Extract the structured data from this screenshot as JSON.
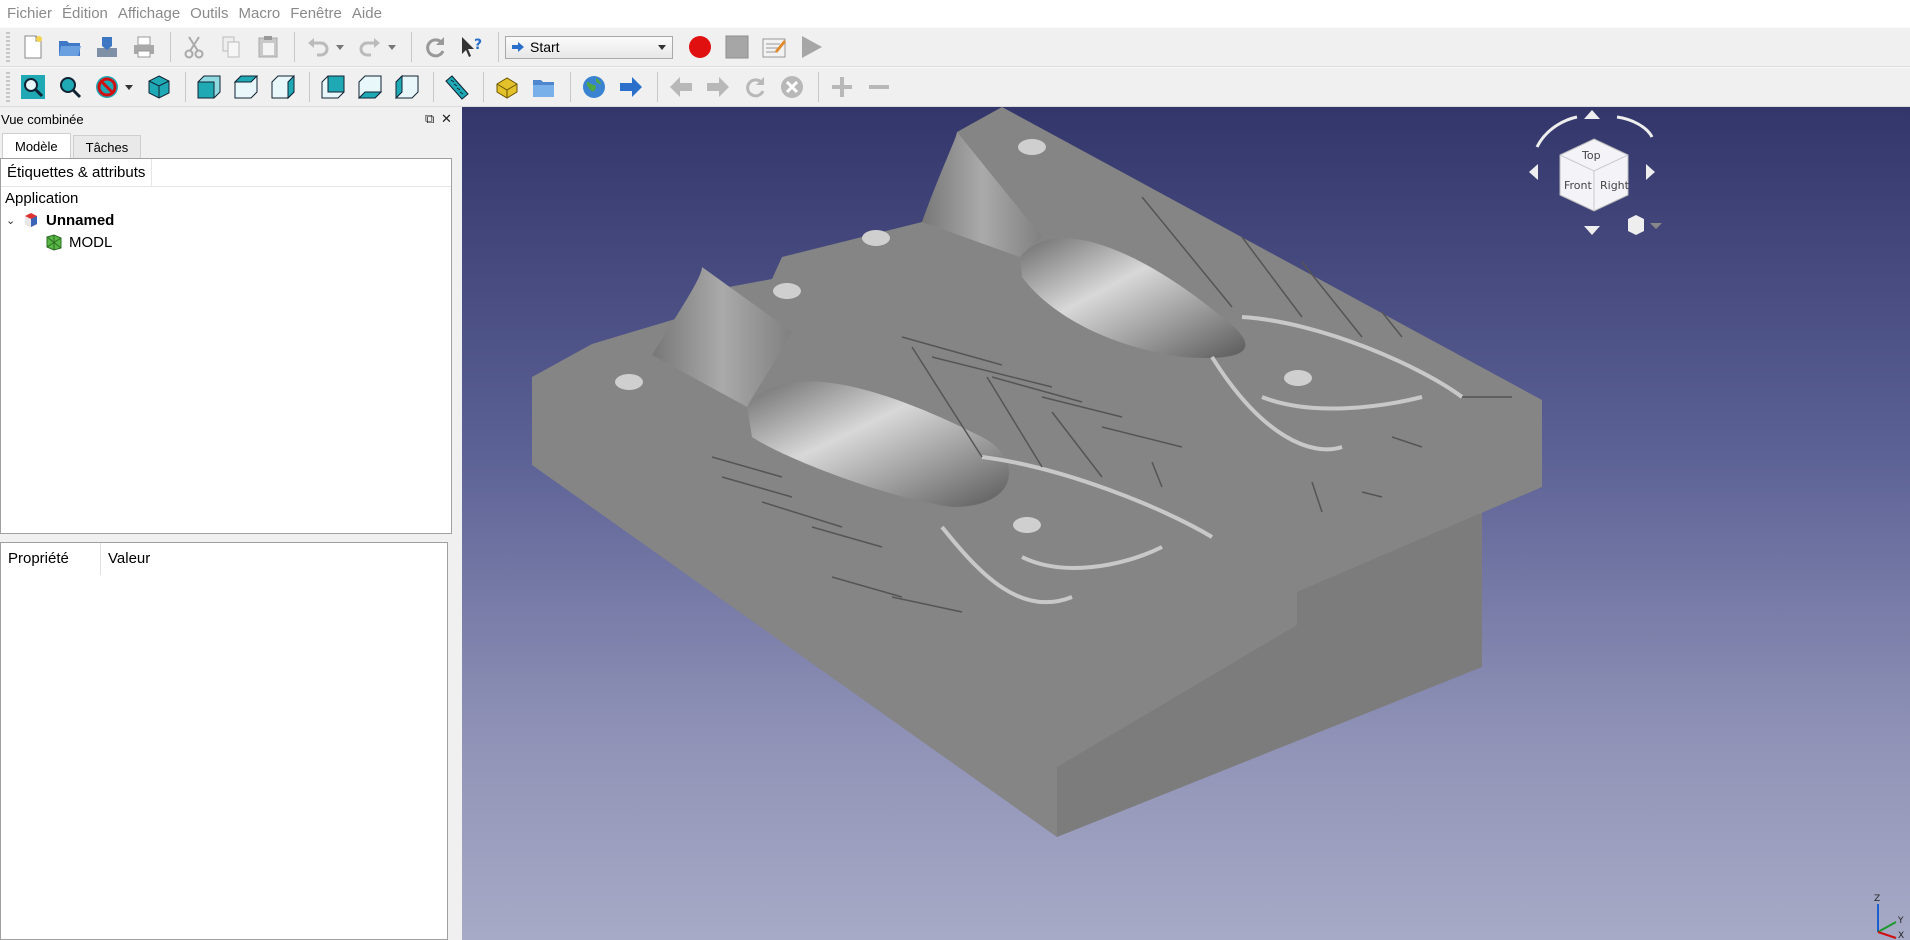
{
  "menu": [
    "Fichier",
    "Édition",
    "Affichage",
    "Outils",
    "Macro",
    "Fenêtre",
    "Aide"
  ],
  "workbench": {
    "selected": "Start"
  },
  "combo_view": {
    "title": "Vue combinée",
    "float_icon": "float-icon",
    "close_icon": "close-icon",
    "tabs": [
      "Modèle",
      "Tâches"
    ],
    "tree": {
      "header": "Étiquettes & attributs",
      "root": "Application",
      "document": "Unnamed",
      "object": "MODL"
    },
    "properties": {
      "col1": "Propriété",
      "col2": "Valeur"
    }
  },
  "navcube": {
    "top": "Top",
    "front": "Front",
    "right": "Right"
  },
  "axis": {
    "z": "Z",
    "y": "Y",
    "x": "X"
  },
  "colors": {
    "record": "#e01010",
    "accent": "#2a6fc9",
    "viewport_top": "#33366a",
    "viewport_bottom": "#a7aac6"
  }
}
